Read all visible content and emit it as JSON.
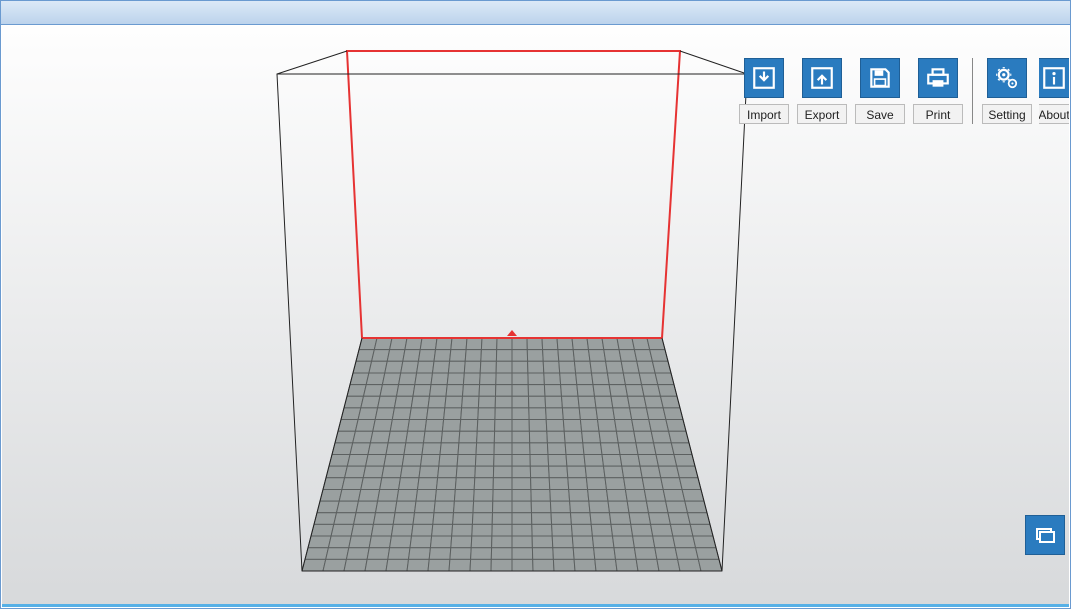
{
  "toolbar": {
    "import_label": "Import",
    "export_label": "Export",
    "save_label": "Save",
    "print_label": "Print",
    "setting_label": "Setting",
    "about_label": "About"
  },
  "viewport": {
    "grid_cols": 20,
    "grid_rows": 20
  },
  "colors": {
    "button_bg": "#2a7bbf",
    "button_border": "#1f5f96",
    "highlight_red": "#e63333",
    "grid_fill": "#9aa0a0",
    "grid_line": "#5c6060"
  }
}
